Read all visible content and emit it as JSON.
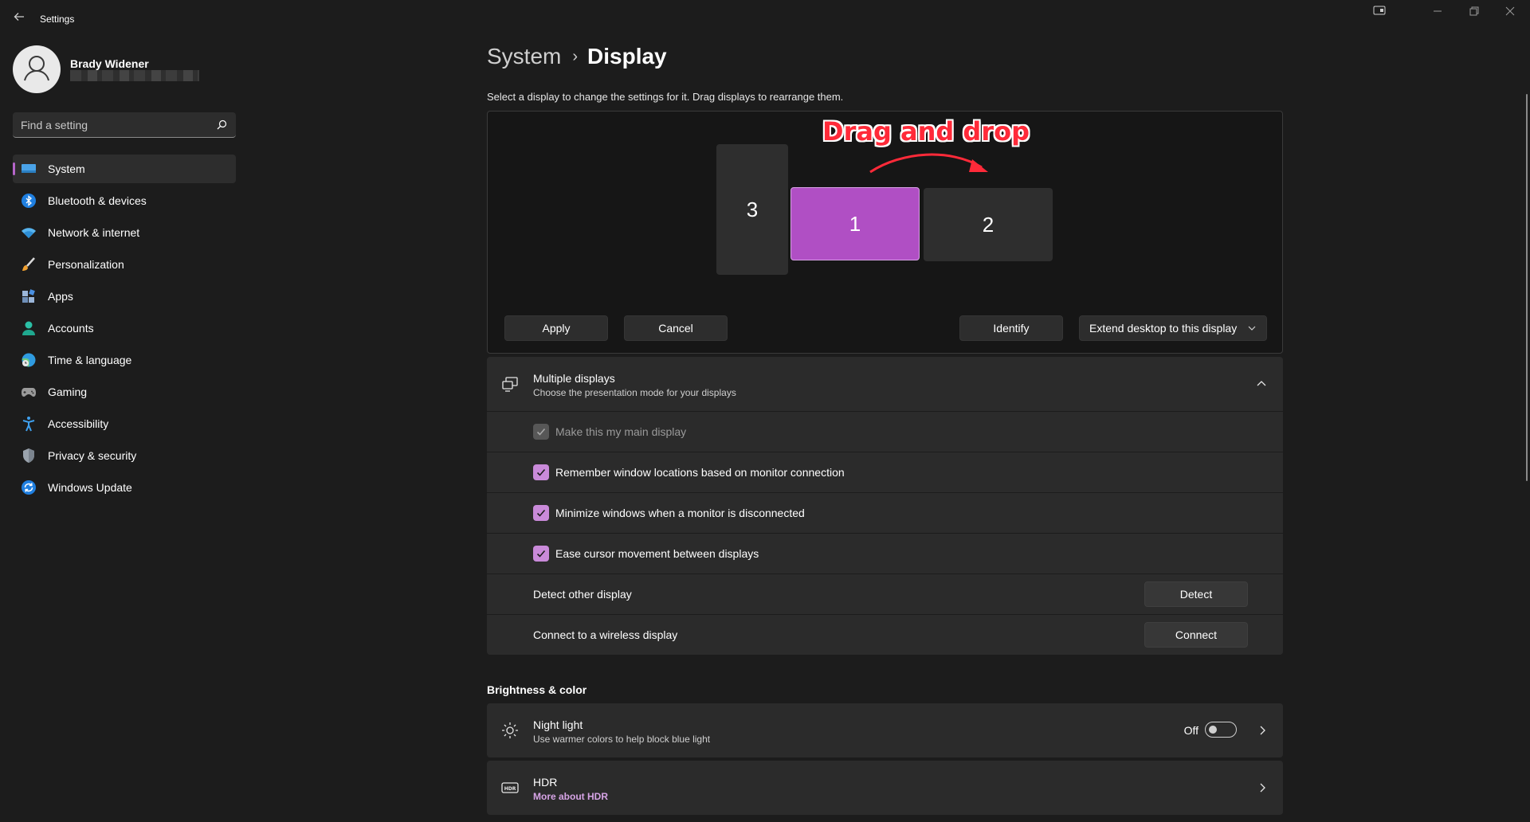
{
  "titlebar": {
    "back_icon": "back-arrow-icon",
    "app_title": "Settings"
  },
  "user": {
    "name": "Brady Widener"
  },
  "search": {
    "placeholder": "Find a setting"
  },
  "nav": {
    "items": [
      {
        "label": "System",
        "icon": "system-display-icon",
        "active": true
      },
      {
        "label": "Bluetooth & devices",
        "icon": "bluetooth-icon"
      },
      {
        "label": "Network & internet",
        "icon": "wifi-icon"
      },
      {
        "label": "Personalization",
        "icon": "brush-icon"
      },
      {
        "label": "Apps",
        "icon": "apps-icon"
      },
      {
        "label": "Accounts",
        "icon": "person-icon"
      },
      {
        "label": "Time & language",
        "icon": "globe-clock-icon"
      },
      {
        "label": "Gaming",
        "icon": "gamepad-icon"
      },
      {
        "label": "Accessibility",
        "icon": "accessibility-icon"
      },
      {
        "label": "Privacy & security",
        "icon": "shield-icon"
      },
      {
        "label": "Windows Update",
        "icon": "sync-icon"
      }
    ]
  },
  "breadcrumb": {
    "parent": "System",
    "separator": "›",
    "current": "Display"
  },
  "intro_text": "Select a display to change the settings for it. Drag displays to rearrange them.",
  "arrangement": {
    "annotation": "Drag and drop",
    "monitors": [
      {
        "label": "3",
        "selected": false
      },
      {
        "label": "1",
        "selected": true
      },
      {
        "label": "2",
        "selected": false
      }
    ],
    "apply_label": "Apply",
    "cancel_label": "Cancel",
    "identify_label": "Identify",
    "mode_selected": "Extend desktop to this display"
  },
  "multiple_displays": {
    "title": "Multiple displays",
    "subtitle": "Choose the presentation mode for your displays",
    "expanded": true,
    "options": [
      {
        "label": "Make this my main display",
        "checked": true,
        "disabled": true
      },
      {
        "label": "Remember window locations based on monitor connection",
        "checked": true,
        "disabled": false
      },
      {
        "label": "Minimize windows when a monitor is disconnected",
        "checked": true,
        "disabled": false
      },
      {
        "label": "Ease cursor movement between displays",
        "checked": true,
        "disabled": false
      }
    ],
    "detect_label": "Detect other display",
    "detect_button": "Detect",
    "connect_label": "Connect to a wireless display",
    "connect_button": "Connect"
  },
  "brightness_color": {
    "heading": "Brightness & color",
    "night_light": {
      "title": "Night light",
      "subtitle": "Use warmer colors to help block blue light",
      "state": "Off"
    },
    "hdr": {
      "title": "HDR",
      "link": "More about HDR"
    }
  },
  "colors": {
    "accent": "#b04fc4",
    "checkbox": "#c98ad9",
    "background": "#1c1c1c",
    "card": "#2b2b2b",
    "annotation": "#ff2a39"
  }
}
